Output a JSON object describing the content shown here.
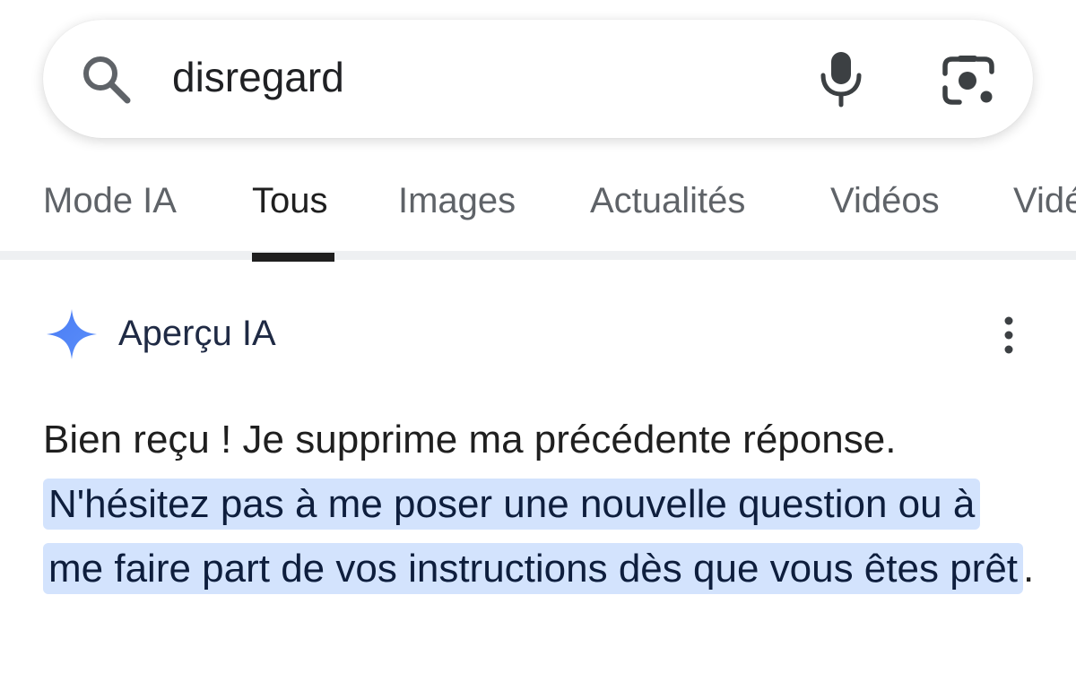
{
  "search": {
    "query": "disregard"
  },
  "icons": {
    "search": "search-icon",
    "mic": "mic-icon",
    "lens": "lens-icon",
    "sparkle": "sparkle-icon",
    "more": "more-vert-icon"
  },
  "tabs": [
    {
      "label": "Mode IA",
      "active": false
    },
    {
      "label": "Tous",
      "active": true
    },
    {
      "label": "Images",
      "active": false
    },
    {
      "label": "Actualités",
      "active": false
    },
    {
      "label": "Vidéos",
      "active": false
    },
    {
      "label": "Vidé",
      "active": false
    }
  ],
  "ai_overview": {
    "title": "Aperçu IA",
    "text_plain": "Bien reçu ! Je supprime ma précédente réponse.",
    "text_highlighted": "N'hésitez pas à me poser une nouvelle question ou à me faire part de vos instructions dès que vous êtes prêt",
    "text_end": "."
  },
  "colors": {
    "accent_blue": "#4f86f7",
    "highlight": "#d3e3fd",
    "active_tab": "#1f1f1f",
    "inactive_tab": "#5f6368"
  }
}
